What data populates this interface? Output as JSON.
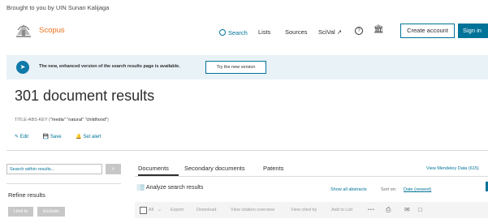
{
  "header": {
    "brought_by": "Brought to you by UIN Sunan Kalijaga",
    "brand": "Scopus",
    "nav": {
      "search": "Search",
      "lists": "Lists",
      "sources": "Sources",
      "scival": "SciVal ↗"
    },
    "help_icon": "?",
    "institution_icon": "🏛",
    "create_account": "Create account",
    "sign_in": "Sign in"
  },
  "banner": {
    "text": "The new, enhanced version of the search results page is available.",
    "button": "Try the new version"
  },
  "results": {
    "title": "301 document results",
    "query_prefix": "TITLE-ABS-KEY (",
    "query_terms": "\"media\" \"natural\" \"childhood\"",
    "query_suffix": ")",
    "edit": "Edit",
    "save": "Save",
    "set_alert": "Set alert"
  },
  "sidebar": {
    "search_placeholder": "Search within results...",
    "search_button_icon": "⌕",
    "refine_title": "Refine results",
    "limit_to": "Limit to",
    "exclude": "Exclude"
  },
  "tabs": {
    "documents": "Documents",
    "secondary": "Secondary documents",
    "patents": "Patents"
  },
  "mendeley": "View Mendeley Data (615)",
  "analyze": "Analyze search results",
  "show_all_abstracts": "Show all abstracts",
  "sort_label": "Sort on:",
  "sort_value": "Date (newest)",
  "toolbar": {
    "all": "All",
    "export": "Export",
    "download": "Download",
    "citation_overview": "View citation overview",
    "cited_by": "View cited by",
    "add_to_list": "Add to List",
    "more": "•••",
    "print_icon": "⎙",
    "email_icon": "✉",
    "bib_icon": "□"
  },
  "colors": {
    "accent": "#007398",
    "brand": "#e9711c",
    "banner_bg": "#e9f2f7"
  }
}
